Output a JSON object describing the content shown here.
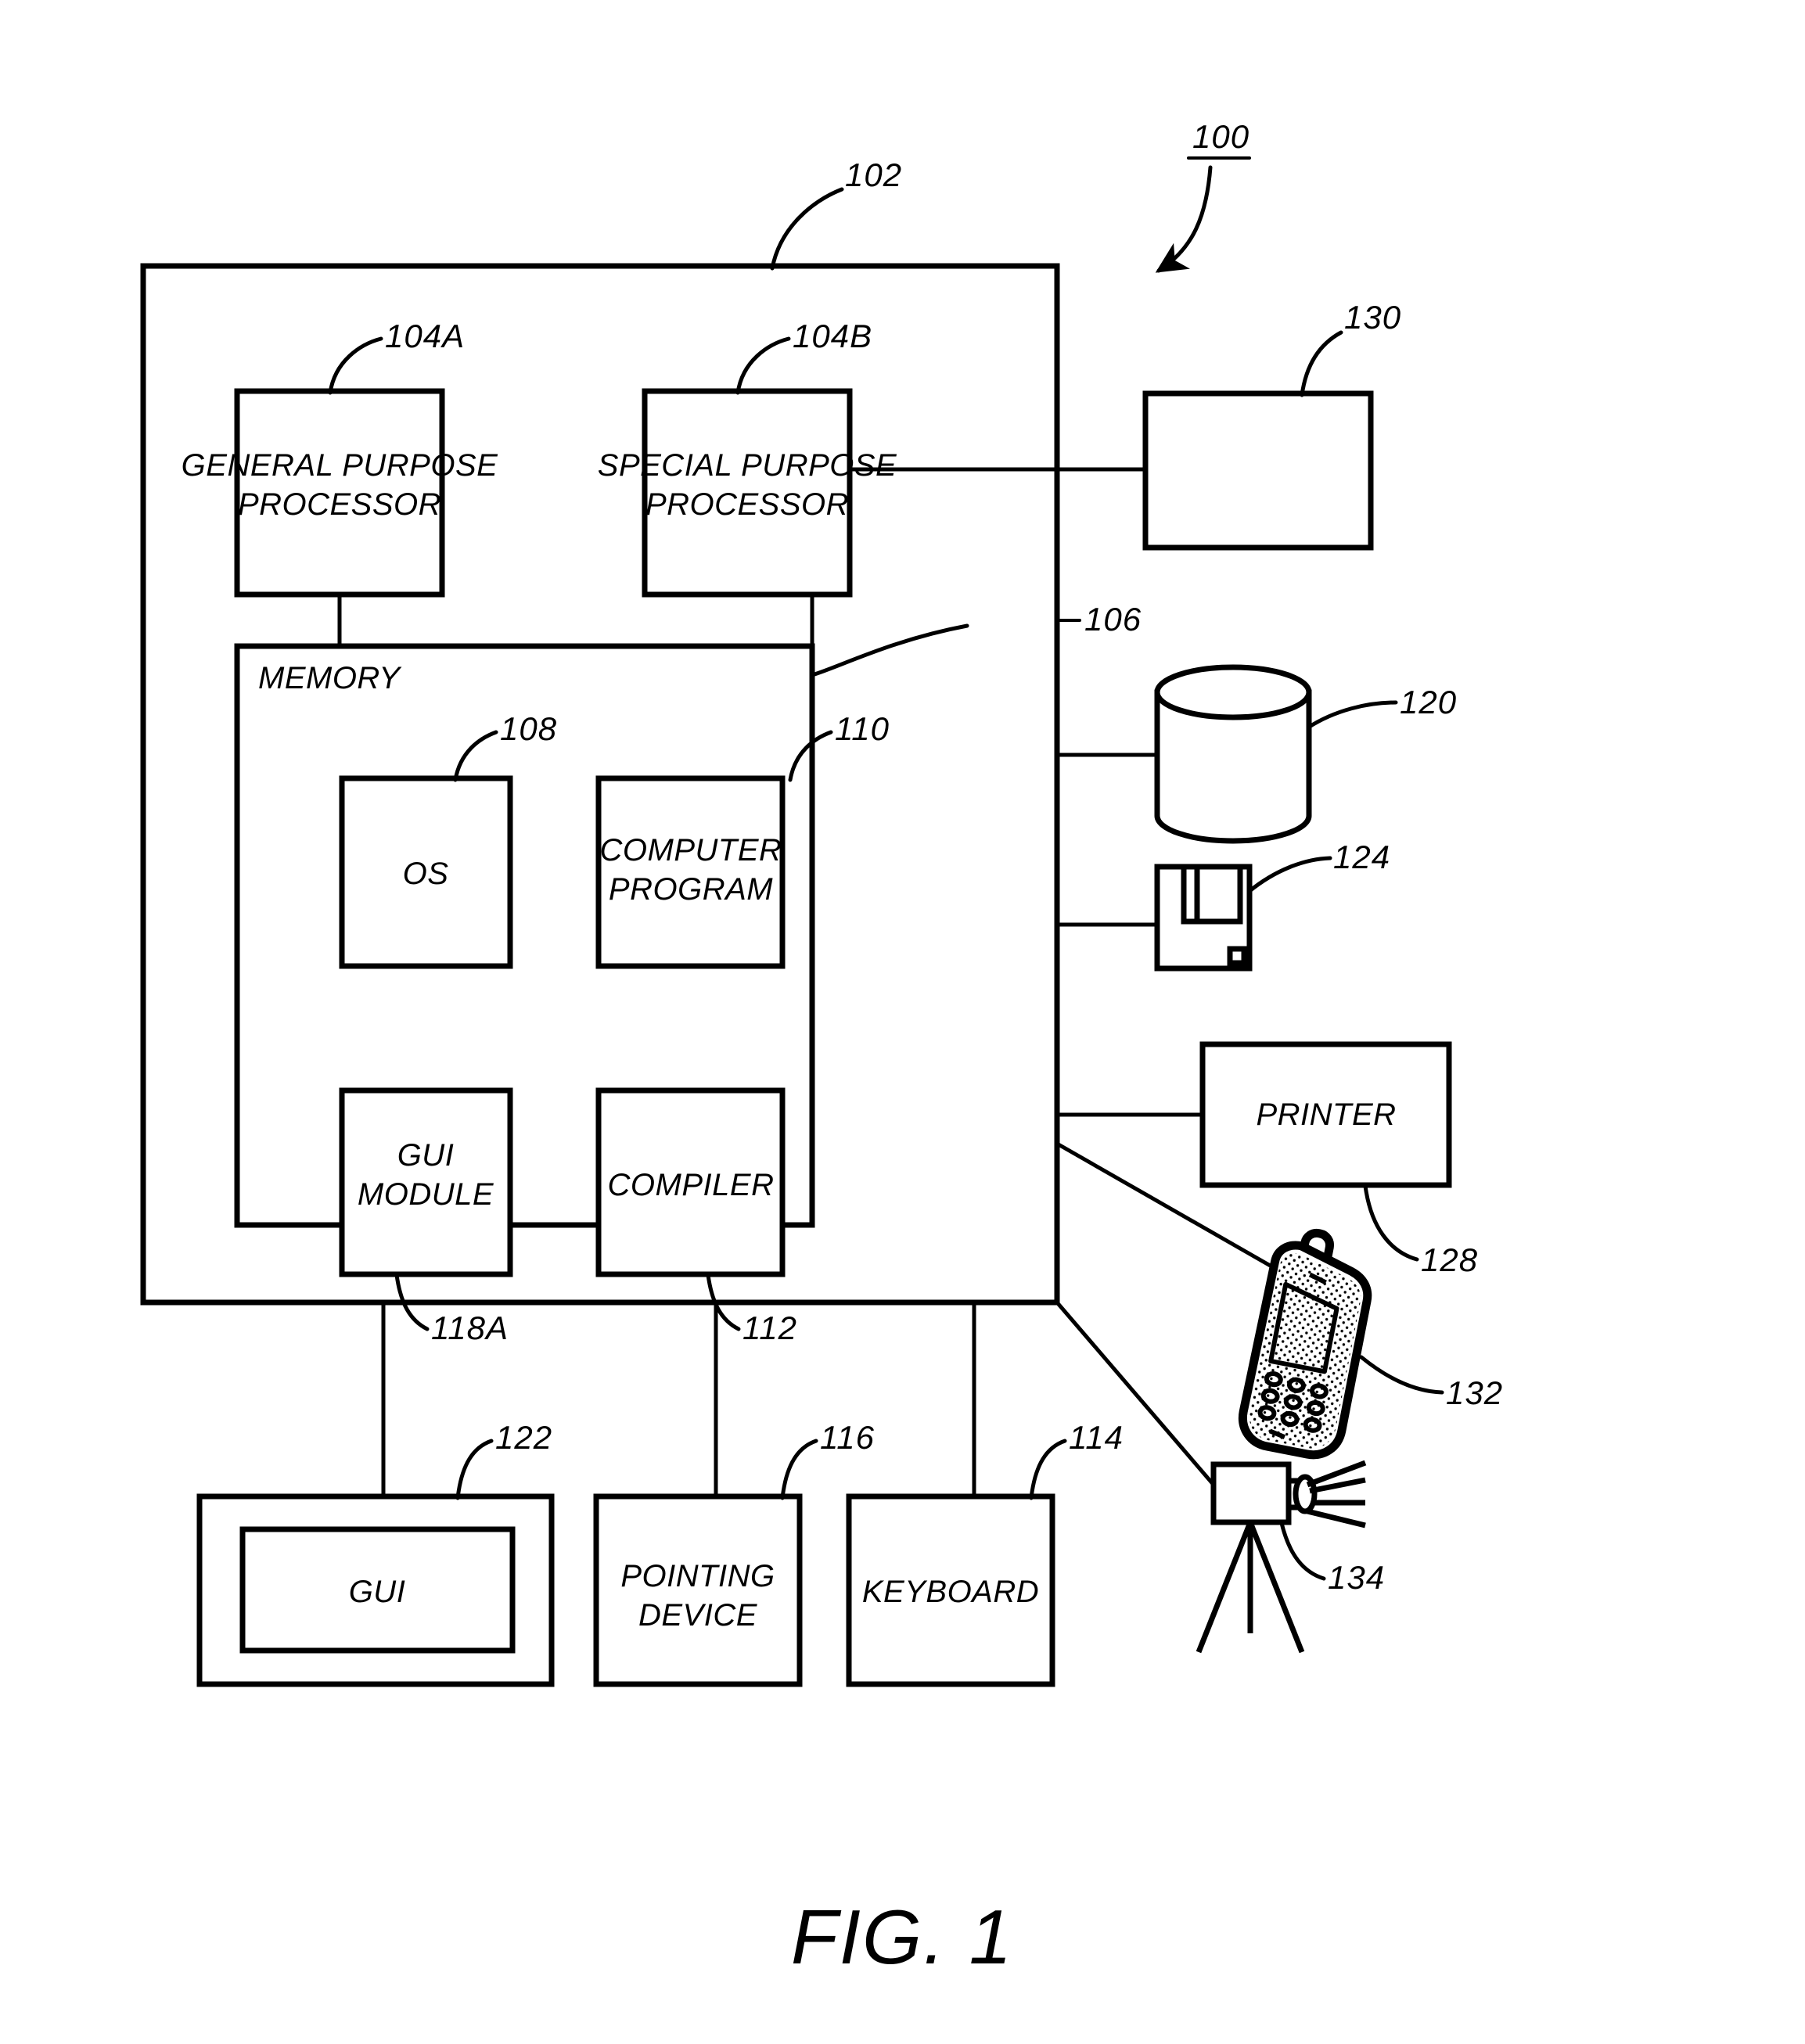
{
  "figure": {
    "caption": "FIG. 1",
    "system_ref": "100"
  },
  "computer": {
    "ref": "102",
    "processors": [
      {
        "ref": "104A",
        "label_line1": "GENERAL PURPOSE",
        "label_line2": "PROCESSOR"
      },
      {
        "ref": "104B",
        "label_line1": "SPECIAL PURPOSE",
        "label_line2": "PROCESSOR"
      }
    ],
    "memory": {
      "ref": "106",
      "label": "MEMORY",
      "modules": [
        {
          "ref": "108",
          "label_line1": "OS",
          "label_line2": ""
        },
        {
          "ref": "110",
          "label_line1": "COMPUTER",
          "label_line2": "PROGRAM"
        },
        {
          "ref": "118A",
          "label_line1": "GUI",
          "label_line2": "MODULE"
        },
        {
          "ref": "112",
          "label_line1": "COMPILER",
          "label_line2": ""
        }
      ]
    }
  },
  "peripherals_right": [
    {
      "ref": "130",
      "label": "",
      "icon": "blank-box-icon"
    },
    {
      "ref": "120",
      "label": "",
      "icon": "data-store-cylinder-icon"
    },
    {
      "ref": "124",
      "label": "",
      "icon": "floppy-disk-icon"
    },
    {
      "ref": "128",
      "label": "PRINTER",
      "icon": "printer-box-icon"
    },
    {
      "ref": "132",
      "label": "",
      "icon": "cell-phone-icon"
    },
    {
      "ref": "134",
      "label": "",
      "icon": "camera-tripod-icon"
    }
  ],
  "peripherals_bottom": [
    {
      "ref": "122",
      "label": "GUI",
      "icon": "monitor-screen-icon"
    },
    {
      "ref": "116",
      "label_line1": "POINTING",
      "label_line2": "DEVICE",
      "icon": "pointing-device-box-icon"
    },
    {
      "ref": "114",
      "label": "KEYBOARD",
      "icon": "keyboard-box-icon"
    }
  ],
  "colors": {
    "stroke": "#000000",
    "background": "#ffffff"
  }
}
